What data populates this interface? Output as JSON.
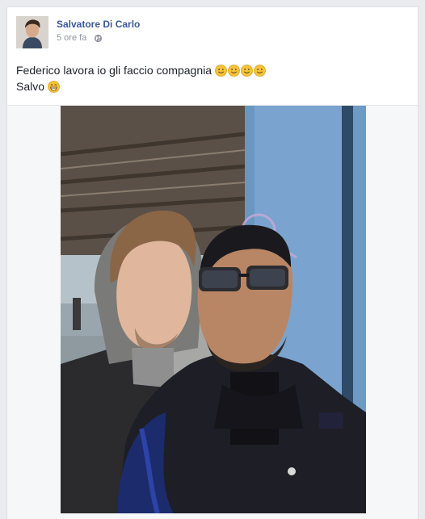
{
  "post": {
    "author_name": "Salvatore Di Carlo",
    "timestamp": "5 ore fa",
    "privacy_icon": "globe-icon",
    "text_line_1": "Federico lavora io gli faccio compagnia",
    "text_line_1_emojis": [
      "smile-emoji",
      "smile-emoji",
      "smile-emoji",
      "smile-emoji"
    ],
    "text_line_2": "Salvo",
    "text_line_2_emojis": [
      "grin-emoji"
    ]
  },
  "colors": {
    "link_blue": "#3b5998",
    "meta_gray": "#90949c",
    "text": "#1d2129",
    "emoji_yellow": "#f5c33b"
  },
  "photo": {
    "subject": "selfie-photo"
  }
}
